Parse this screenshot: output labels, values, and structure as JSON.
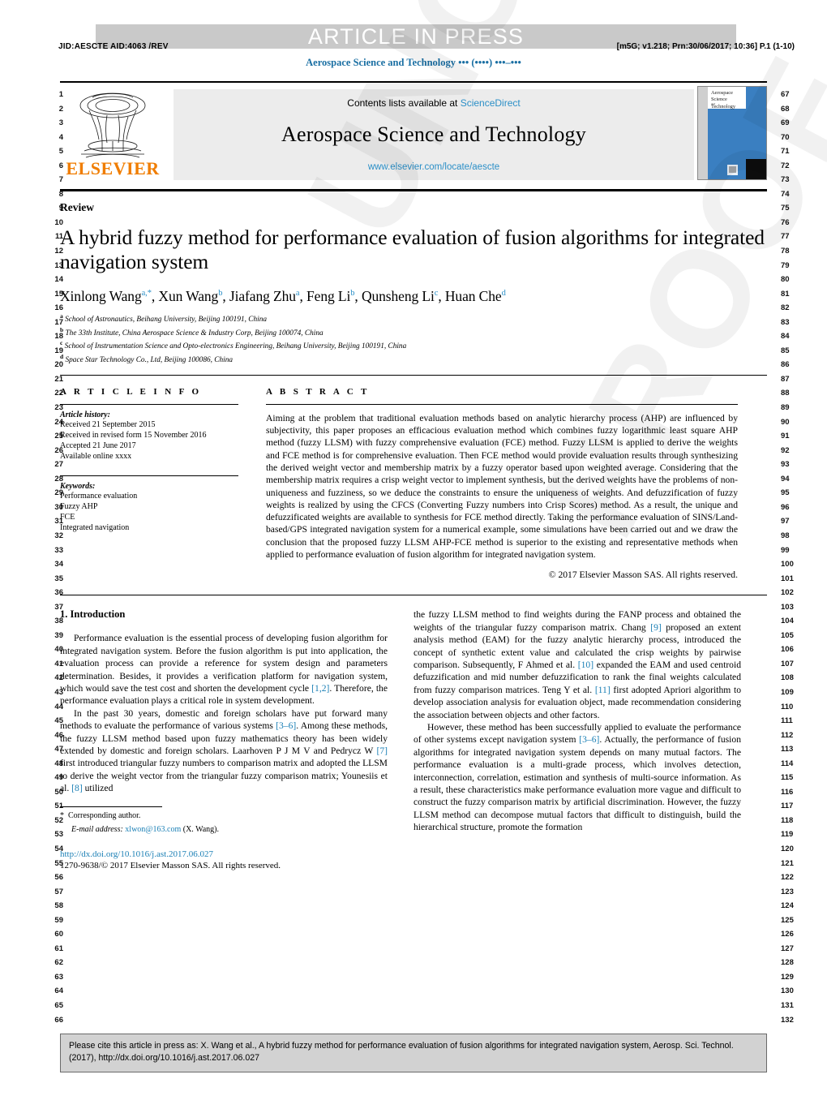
{
  "banner": {
    "press_label": "ARTICLE IN PRESS",
    "jid": "JID:AESCTE     AID:4063 /REV",
    "prn": "[m5G; v1.218; Prn:30/06/2017; 10:36] P.1 (1-10)",
    "running_head": "Aerospace Science and Technology ••• (••••) •••–•••"
  },
  "masthead": {
    "contents_prefix": "Contents lists available at ",
    "sciencedirect": "ScienceDirect",
    "journal_title": "Aerospace Science and Technology",
    "journal_url": "www.elsevier.com/locate/aescte",
    "publisher": "ELSEVIER",
    "cover_line1": "Aerospace",
    "cover_line2": "Science",
    "cover_line3": "and",
    "cover_line4": "Technology"
  },
  "article": {
    "type_label": "Review",
    "title": "A hybrid fuzzy method for performance evaluation of fusion algorithms for integrated navigation system",
    "authors_html": "Xinlong Wang<sup>a,*</sup>, Xun Wang<sup>b</sup>, Jiafang Zhu<sup>a</sup>, Feng Li<sup>b</sup>, Qunsheng Li<sup>c</sup>, Huan Che<sup>d</sup>",
    "affiliations": [
      {
        "mark": "a",
        "text": "School of Astronautics, Beihang University, Beijing 100191, China"
      },
      {
        "mark": "b",
        "text": "The 33th Institute, China Aerospace Science & Industry Corp, Beijing 100074, China"
      },
      {
        "mark": "c",
        "text": "School of Instrumentation Science and Opto-electronics Engineering, Beihang University, Beijing 100191, China"
      },
      {
        "mark": "d",
        "text": "Space Star Technology Co., Ltd, Beijing 100086, China"
      }
    ]
  },
  "info": {
    "heading": "A R T I C L E    I N F O",
    "history_label": "Article history:",
    "history": [
      "Received 21 September 2015",
      "Received in revised form 15 November 2016",
      "Accepted 21 June 2017",
      "Available online xxxx"
    ],
    "keywords_label": "Keywords:",
    "keywords": [
      "Performance evaluation",
      "Fuzzy AHP",
      "FCE",
      "Integrated navigation"
    ]
  },
  "abstract": {
    "heading": "A B S T R A C T",
    "text": "Aiming at the problem that traditional evaluation methods based on analytic hierarchy process (AHP) are influenced by subjectivity, this paper proposes an efficacious evaluation method which combines fuzzy logarithmic least square AHP method (fuzzy LLSM) with fuzzy comprehensive evaluation (FCE) method. Fuzzy LLSM is applied to derive the weights and FCE method is for comprehensive evaluation. Then FCE method would provide evaluation results through synthesizing the derived weight vector and membership matrix by a fuzzy operator based upon weighted average. Considering that the membership matrix requires a crisp weight vector to implement synthesis, but the derived weights have the problems of non-uniqueness and fuzziness, so we deduce the constraints to ensure the uniqueness of weights. And defuzzification of fuzzy weights is realized by using the CFCS (Converting Fuzzy numbers into Crisp Scores) method. As a result, the unique and defuzzificated weights are available to synthesis for FCE method directly. Taking the performance evaluation of SINS/Land-based/GPS integrated navigation system for a numerical example, some simulations have been carried out and we draw the conclusion that the proposed fuzzy LLSM AHP-FCE method is superior to the existing and representative methods when applied to performance evaluation of fusion algorithm for integrated navigation system.",
    "copyright": "© 2017 Elsevier Masson SAS. All rights reserved."
  },
  "body": {
    "section_heading": "1. Introduction",
    "left_paragraphs": [
      "Performance evaluation is the essential process of developing fusion algorithm for integrated navigation system. Before the fusion algorithm is put into application, the evaluation process can provide a reference for system design and parameters determination. Besides, it provides a verification platform for navigation system, which would save the test cost and shorten the development cycle [1,2]. Therefore, the performance evaluation plays a critical role in system development.",
      "In the past 30 years, domestic and foreign scholars have put forward many methods to evaluate the performance of various systems [3–6]. Among these methods, the fuzzy LLSM method based upon fuzzy mathematics theory has been widely extended by domestic and foreign scholars. Laarhoven P J M V and Pedrycz W [7] first introduced triangular fuzzy numbers to comparison matrix and adopted the LLSM to derive the weight vector from the triangular fuzzy comparison matrix; Younesiis et al. [8] utilized"
    ],
    "right_paragraphs": [
      "the fuzzy LLSM method to find weights during the FANP process and obtained the weights of the triangular fuzzy comparison matrix. Chang [9] proposed an extent analysis method (EAM) for the fuzzy analytic hierarchy process, introduced the concept of synthetic extent value and calculated the crisp weights by pairwise comparison. Subsequently, F Ahmed et al. [10] expanded the EAM and used centroid defuzzification and mid number defuzzification to rank the final weights calculated from fuzzy comparison matrices. Teng Y et al. [11] first adopted Apriori algorithm to develop association analysis for evaluation object, made recommendation considering the association between objects and other factors.",
      "However, these method has been successfully applied to evaluate the performance of other systems except navigation system [3–6]. Actually, the performance of fusion algorithms for integrated navigation system depends on many mutual factors. The performance evaluation is a multi-grade process, which involves detection, interconnection, correlation, estimation and synthesis of multi-source information. As a result, these characteristics make performance evaluation more vague and difficult to construct the fuzzy comparison matrix by artificial discrimination. However, the fuzzy LLSM method can decompose mutual factors that difficult to distinguish, build the hierarchical structure, promote the formation"
    ]
  },
  "footnote": {
    "corresponding": "Corresponding author.",
    "email_label": "E-mail address:",
    "email": "xlwon@163.com",
    "email_suffix": "(X. Wang).",
    "doi": "http://dx.doi.org/10.1016/j.ast.2017.06.027",
    "issn": "1270-9638/© 2017 Elsevier Masson SAS. All rights reserved."
  },
  "cite_box": {
    "text": "Please cite this article in press as: X. Wang et al., A hybrid fuzzy method for performance evaluation of fusion algorithms for integrated navigation system, Aerosp. Sci. Technol. (2017), http://dx.doi.org/10.1016/j.ast.2017.06.027"
  },
  "line_numbers": {
    "left_start": 1,
    "left_end": 66,
    "right_start": 67,
    "right_end": 132
  },
  "watermark": {
    "line1": "UNCORRECTED",
    "line2": "PROOF"
  },
  "colors": {
    "link": "#1a7fb5",
    "sciencedirect": "#2b8fc7",
    "elsevier_orange": "#F07D00",
    "banner_grey": "#c9c9c9",
    "cover_blue": "#3a7fc1"
  }
}
